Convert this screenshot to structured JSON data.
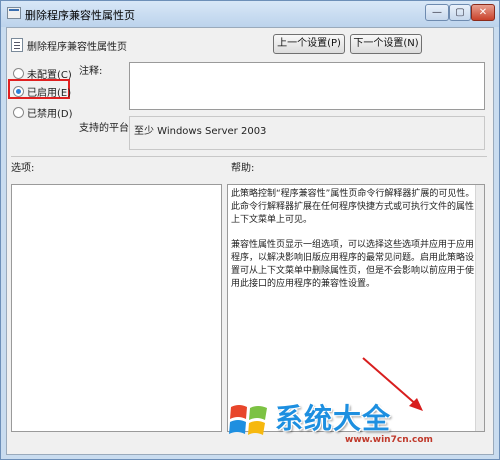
{
  "window": {
    "title": "删除程序兼容性属性页",
    "controls": {
      "minimize": "—",
      "maximize": "▢",
      "close": "✕"
    }
  },
  "header": {
    "policy_title": "删除程序兼容性属性页",
    "prev_button": "上一个设置(P)",
    "next_button": "下一个设置(N)"
  },
  "state_options": [
    {
      "label": "未配置(C)",
      "checked": false
    },
    {
      "label": "已启用(E)",
      "checked": true
    },
    {
      "label": "已禁用(D)",
      "checked": false
    }
  ],
  "highlight_color": "#e02020",
  "comment": {
    "label": "注释:",
    "value": ""
  },
  "platform": {
    "label": "支持的平台:",
    "value": "至少 Windows Server 2003"
  },
  "options": {
    "label": "选项:"
  },
  "help": {
    "label": "帮助:",
    "paragraphs": [
      "此策略控制“程序兼容性”属性页命令行解释器扩展的可见性。此命令行解释器扩展在任何程序快捷方式或可执行文件的属性上下文菜单上可见。",
      "兼容性属性页显示一组选项，可以选择这些选项并应用于应用程序，以解决影响旧版应用程序的最常见问题。启用此策略设置可从上下文菜单中删除属性页，但是不会影响以前应用于使用此接口的应用程序的兼容性设置。"
    ]
  },
  "watermark": {
    "title": "系统大全",
    "url": "www.win7cn.com"
  }
}
